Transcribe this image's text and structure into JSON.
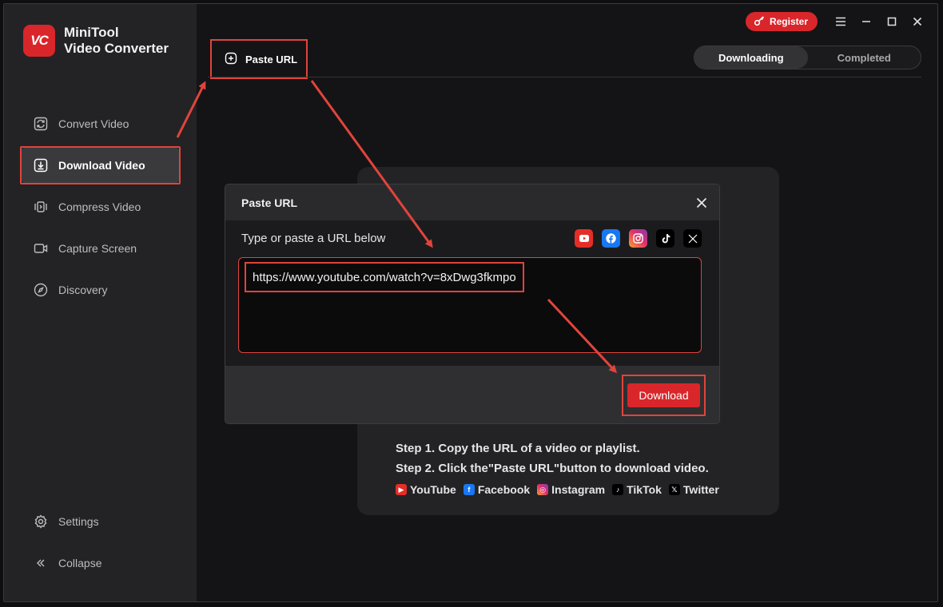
{
  "app": {
    "name_line1": "MiniTool",
    "name_line2": "Video Converter",
    "logo_text": "VC"
  },
  "sidebar": {
    "items": [
      {
        "label": "Convert Video",
        "icon": "refresh-icon"
      },
      {
        "label": "Download Video",
        "icon": "download-icon",
        "active": true
      },
      {
        "label": "Compress Video",
        "icon": "compress-icon"
      },
      {
        "label": "Capture Screen",
        "icon": "camera-icon"
      },
      {
        "label": "Discovery",
        "icon": "compass-icon"
      }
    ],
    "bottom": [
      {
        "label": "Settings",
        "icon": "gear-icon"
      },
      {
        "label": "Collapse",
        "icon": "double-chevron-left-icon"
      }
    ]
  },
  "topbar": {
    "register_label": "Register",
    "paste_url_label": "Paste URL",
    "tabs": [
      {
        "label": "Downloading",
        "active": true
      },
      {
        "label": "Completed",
        "active": false
      }
    ]
  },
  "empty_state": {
    "step1": "Step 1. Copy the URL of a video or playlist.",
    "step2": "Step 2. Click the\"Paste URL\"button to download video.",
    "platforms": [
      "YouTube",
      "Facebook",
      "Instagram",
      "TikTok",
      "Twitter"
    ]
  },
  "dialog": {
    "title": "Paste URL",
    "label": "Type or paste a URL below",
    "url_value": "https://www.youtube.com/watch?v=8xDwg3fkmpo",
    "download_label": "Download",
    "social_icons": [
      "youtube-icon",
      "facebook-icon",
      "instagram-icon",
      "tiktok-icon",
      "x-twitter-icon"
    ]
  },
  "colors": {
    "accent": "#d9262b",
    "highlight": "#e0443c",
    "sidebar_bg": "#232325",
    "main_bg": "#141416"
  }
}
